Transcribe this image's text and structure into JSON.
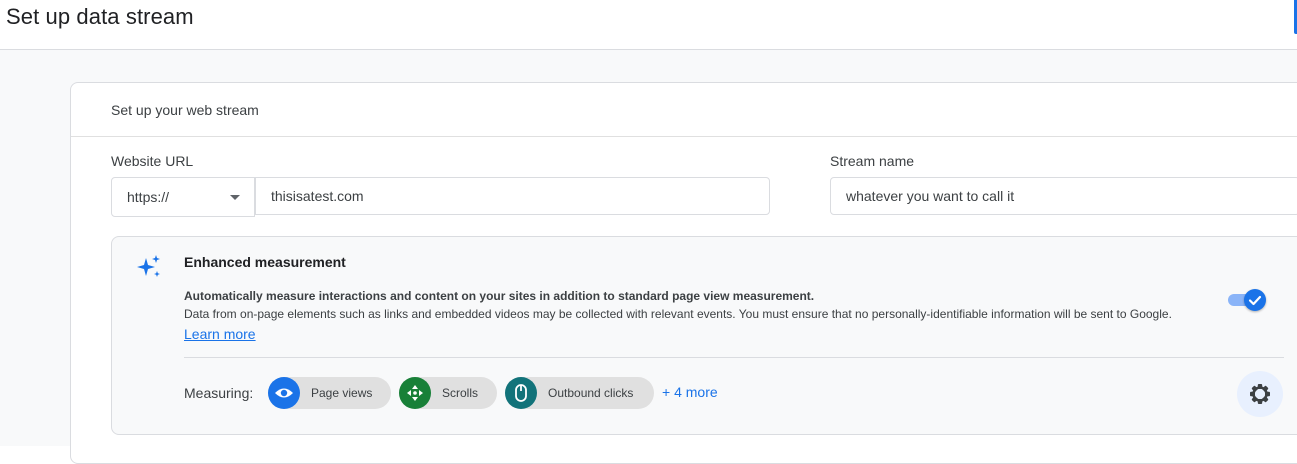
{
  "page": {
    "title": "Set up data stream"
  },
  "card": {
    "title": "Set up your web stream"
  },
  "website_url": {
    "label": "Website URL",
    "protocol": "https://",
    "value": "thisisatest.com"
  },
  "stream_name": {
    "label": "Stream name",
    "value": "whatever you want to call it"
  },
  "enhanced_measurement": {
    "title": "Enhanced measurement",
    "description_bold": "Automatically measure interactions and content on your sites in addition to standard page view measurement.",
    "description": "Data from on-page elements such as links and embedded videos may be collected with relevant events. You must ensure that no personally-identifiable information will be sent to Google.",
    "learn_more": "Learn more",
    "enabled": true,
    "measuring_label": "Measuring:",
    "chips": [
      {
        "label": "Page views",
        "icon": "eye-icon",
        "color": "#1a73e8"
      },
      {
        "label": "Scrolls",
        "icon": "scroll-arrows-icon",
        "color": "#188038"
      },
      {
        "label": "Outbound clicks",
        "icon": "mouse-icon",
        "color": "#12737a"
      }
    ],
    "more": "+ 4 more",
    "settings_icon": "gear-icon"
  },
  "colors": {
    "accent": "#1a73e8",
    "toggle_track": "#8ab4f8"
  }
}
